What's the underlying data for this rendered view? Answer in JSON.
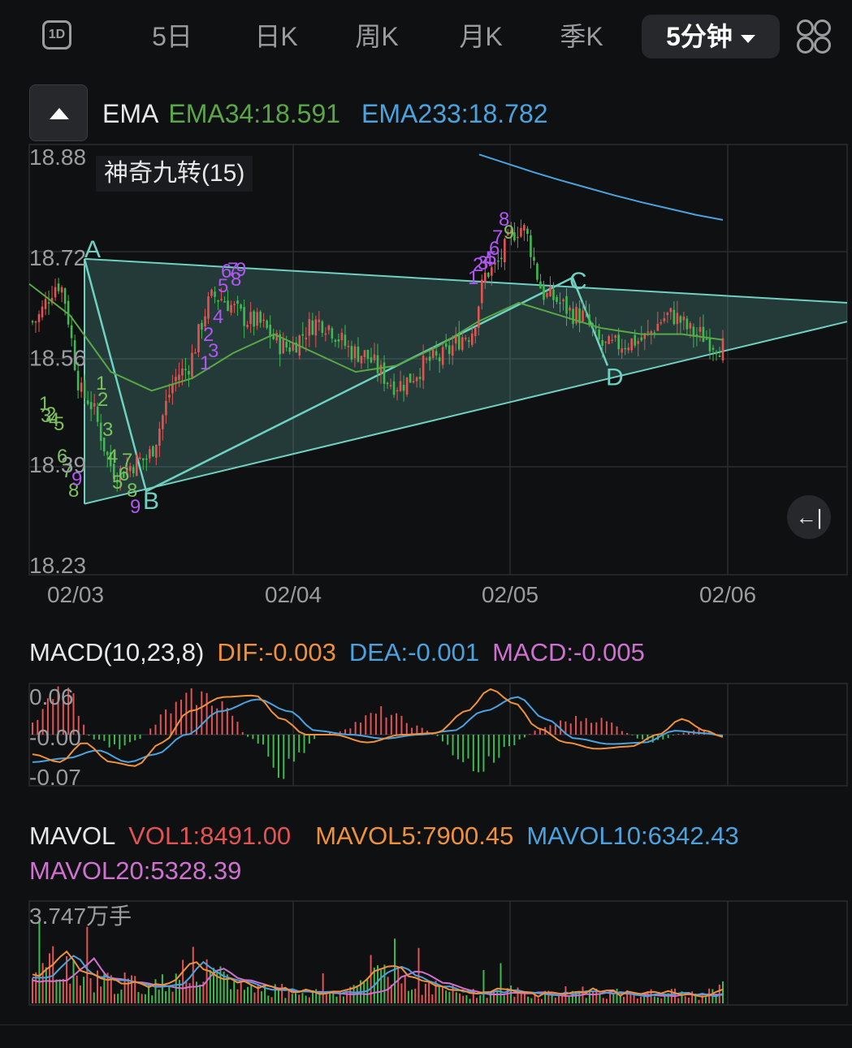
{
  "tabs": {
    "items": [
      {
        "label": "5日"
      },
      {
        "label": "日K"
      },
      {
        "label": "周K"
      },
      {
        "label": "月K"
      },
      {
        "label": "季K"
      }
    ],
    "active": "5分钟",
    "one_day_icon": "1D"
  },
  "ema_legend": {
    "name": "EMA",
    "ema34": "EMA34:18.591",
    "ema233": "EMA233:18.782"
  },
  "indicator_tag": "神奇九转(15)",
  "macd_legend": {
    "name": "MACD(10,23,8)",
    "dif": "DIF:-0.003",
    "dea": "DEA:-0.001",
    "macd": "MACD:-0.005"
  },
  "mavol_legend": {
    "name": "MAVOL",
    "vol1": "VOL1:8491.00",
    "mavol5": "MAVOL5:7900.45",
    "mavol10": "MAVOL10:6342.43",
    "mavol20": "MAVOL20:5328.39"
  },
  "back_icon": "←|",
  "colors": {
    "up": "#e25353",
    "down": "#3fb950",
    "ema34": "#5aa845",
    "ema233": "#4aa3df",
    "dif": "#f0913a",
    "dea": "#4aa3df",
    "macd": "#d070d0",
    "pattern": "#6fd1c1",
    "td_green": "#7cc05c",
    "td_purple": "#b056f2"
  },
  "chart_data": [
    {
      "type": "candlestick",
      "panel": "price",
      "x_labels": [
        "02/03",
        "02/04",
        "02/05",
        "02/06"
      ],
      "y_ticks": [
        "18.88",
        "18.72",
        "18.56",
        "18.39",
        "18.23"
      ],
      "ylim": [
        18.23,
        18.88
      ],
      "ema233": [
        18.886,
        18.872,
        18.858,
        18.845,
        18.833,
        18.821,
        18.81,
        18.8,
        18.79,
        18.782
      ],
      "ema34": [
        18.68,
        18.63,
        18.54,
        18.51,
        18.53,
        18.57,
        18.6,
        18.57,
        18.54,
        18.55,
        18.58,
        18.62,
        18.65,
        18.63,
        18.61,
        18.6,
        18.6,
        18.591
      ],
      "pattern_points": [
        {
          "label": "A",
          "value": 18.72
        },
        {
          "label": "B",
          "value": 18.35
        },
        {
          "label": "C",
          "value": 18.69
        },
        {
          "label": "D",
          "value": 18.55
        }
      ]
    },
    {
      "type": "bar+line",
      "panel": "macd",
      "y_ticks": [
        "0.06",
        "-0.00",
        "-0.07"
      ],
      "series": [
        {
          "name": "DIF"
        },
        {
          "name": "DEA"
        },
        {
          "name": "MACD"
        }
      ]
    },
    {
      "type": "bar+line",
      "panel": "volume",
      "y_ticks": [
        "3.747万手"
      ],
      "series": [
        {
          "name": "VOL1"
        },
        {
          "name": "MAVOL5"
        },
        {
          "name": "MAVOL10"
        },
        {
          "name": "MAVOL20"
        }
      ]
    }
  ]
}
